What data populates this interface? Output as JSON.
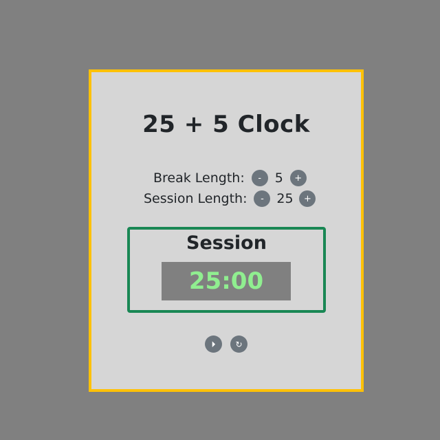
{
  "title": "25 + 5 Clock",
  "break": {
    "label": "Break Length:",
    "value": "5",
    "decrement_label": "-",
    "increment_label": "+"
  },
  "session": {
    "label": "Session Length:",
    "value": "25",
    "decrement_label": "-",
    "increment_label": "+"
  },
  "timer": {
    "label": "Session",
    "time": "25:00"
  },
  "controls": {
    "start_stop_icon": "play-pause-icon",
    "start_stop_glyph": "⏵",
    "reset_icon": "reset-icon",
    "reset_glyph": "↻"
  },
  "colors": {
    "background": "#808080",
    "card": "#d6d6d6",
    "card_border": "#ffc107",
    "timer_border": "#198754",
    "time_text": "#90ee90",
    "button": "#6c757d"
  }
}
